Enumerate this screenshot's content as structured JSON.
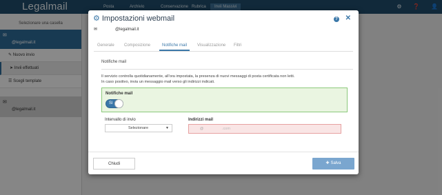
{
  "app": {
    "logo": "Legalmail",
    "nav": [
      "Posta",
      "Archivio",
      "Conservazione",
      "Rubrica",
      "Invii Massivi"
    ],
    "active_nav_index": 4,
    "top_icons": [
      "gear-icon",
      "help-icon",
      "user-icon"
    ]
  },
  "sidebar": {
    "header": "Selezionare una casella",
    "mailbox1": "@legalmail.it",
    "items": [
      "Nuovo invio",
      "Invii effettuati",
      "Scegli template"
    ],
    "mailbox2": "@legalmail.it"
  },
  "modal": {
    "title": "Impostazioni webmail",
    "account": "@legalmail.it",
    "tabs": [
      "Generale",
      "Composizione",
      "Notifiche mail",
      "Visualizzazione",
      "Filtri"
    ],
    "active_tab_index": 2,
    "section_title": "Notifiche mail",
    "description_line1": "Il servizio controlla quotidianamente, all'ora impostata, la presenza di nuovi messaggi di posta certificata non letti.",
    "description_line2": "In caso positivo, invia un messaggio mail verso gli indirizzi indicati.",
    "notify_label": "Notifiche mail",
    "toggle_label": "Sì",
    "toggle_on": true,
    "interval_label": "Intervallo di invio",
    "interval_value": "Selezionare",
    "address_label": "Indirizzi mail",
    "address_at": "@",
    "address_domain": ".com",
    "close_button": "Chiudi",
    "save_button": "Salva"
  },
  "colors": {
    "topbar": "#1f4c6a",
    "accent": "#3a77a8",
    "success_bg": "#eaf5e1",
    "error_bg": "#f9e5e5"
  }
}
